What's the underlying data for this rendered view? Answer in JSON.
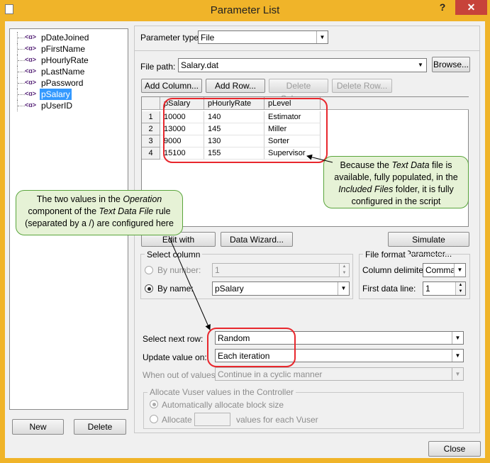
{
  "window": {
    "title": "Parameter List",
    "help_glyph": "?",
    "close_glyph": "✕"
  },
  "tree": {
    "items": [
      {
        "label": "pDateJoined",
        "icon": "parameter-icon",
        "selected": false
      },
      {
        "label": "pFirstName",
        "icon": "parameter-icon",
        "selected": false
      },
      {
        "label": "pHourlyRate",
        "icon": "parameter-icon",
        "selected": false
      },
      {
        "label": "pLastName",
        "icon": "parameter-icon",
        "selected": false
      },
      {
        "label": "pPassword",
        "icon": "parameter-icon",
        "selected": false
      },
      {
        "label": "pSalary",
        "icon": "parameter-icon",
        "selected": true
      },
      {
        "label": "pUserID",
        "icon": "parameter-icon",
        "selected": false
      }
    ],
    "icon_glyph": "<ɑ>"
  },
  "bottom_buttons": {
    "new_label": "New",
    "delete_label": "Delete",
    "close_label": "Close"
  },
  "param_type": {
    "label": "Parameter type:",
    "value": "File"
  },
  "file_path": {
    "label": "File path:",
    "value": "Salary.dat",
    "browse_label": "Browse..."
  },
  "toolbar": {
    "add_column": "Add Column...",
    "add_row": "Add Row...",
    "delete_column": "Delete Column...",
    "delete_row": "Delete Row..."
  },
  "table": {
    "columns": [
      "pSalary",
      "pHourlyRate",
      "pLevel"
    ],
    "rows": [
      {
        "num": "1",
        "cells": [
          "10000",
          "140",
          "Estimator"
        ]
      },
      {
        "num": "2",
        "cells": [
          "13000",
          "145",
          "Miller"
        ]
      },
      {
        "num": "3",
        "cells": [
          "9000",
          "130",
          "Sorter"
        ]
      },
      {
        "num": "4",
        "cells": [
          "15100",
          "155",
          "Supervisor"
        ]
      }
    ]
  },
  "actions": {
    "edit_notepad": "Edit with Notepad...",
    "data_wizard": "Data Wizard...",
    "simulate": "Simulate Parameter..."
  },
  "select_column": {
    "title": "Select column",
    "by_number_label": "By number:",
    "by_number_value": "1",
    "by_name_label": "By name:",
    "by_name_value": "pSalary",
    "selected_mode": "by_name"
  },
  "file_format": {
    "title": "File format",
    "delimiter_label": "Column delimiter:",
    "delimiter_value": "Comma",
    "first_line_label": "First data line:",
    "first_line_value": "1"
  },
  "row_settings": {
    "select_next_row_label": "Select next row:",
    "select_next_row_value": "Random",
    "update_value_label": "Update value on:",
    "update_value_value": "Each iteration",
    "out_of_values_label": "When out of values:",
    "out_of_values_value": "Continue in a cyclic manner"
  },
  "allocate": {
    "title": "Allocate Vuser values in the Controller",
    "auto_label": "Automatically allocate block size",
    "manual_label": "Allocate",
    "manual_suffix": "values for each Vuser"
  },
  "callouts": {
    "right_parts": [
      "Because the ",
      "Text Data",
      " file is available, fully populated, in the ",
      "Included Files",
      " folder, it is fully configured in the script"
    ],
    "left_parts": [
      "The two values in the ",
      "Operation",
      " component of the ",
      "Text Data File",
      " rule (separated by a /) are configured here"
    ]
  },
  "colors": {
    "title_bar": "#f0b429",
    "callout_fill": "#e6f2d6",
    "callout_border": "#5aa53c",
    "highlight_red": "#e8272d",
    "selection": "#3399ff",
    "close_button": "#c7433a"
  }
}
